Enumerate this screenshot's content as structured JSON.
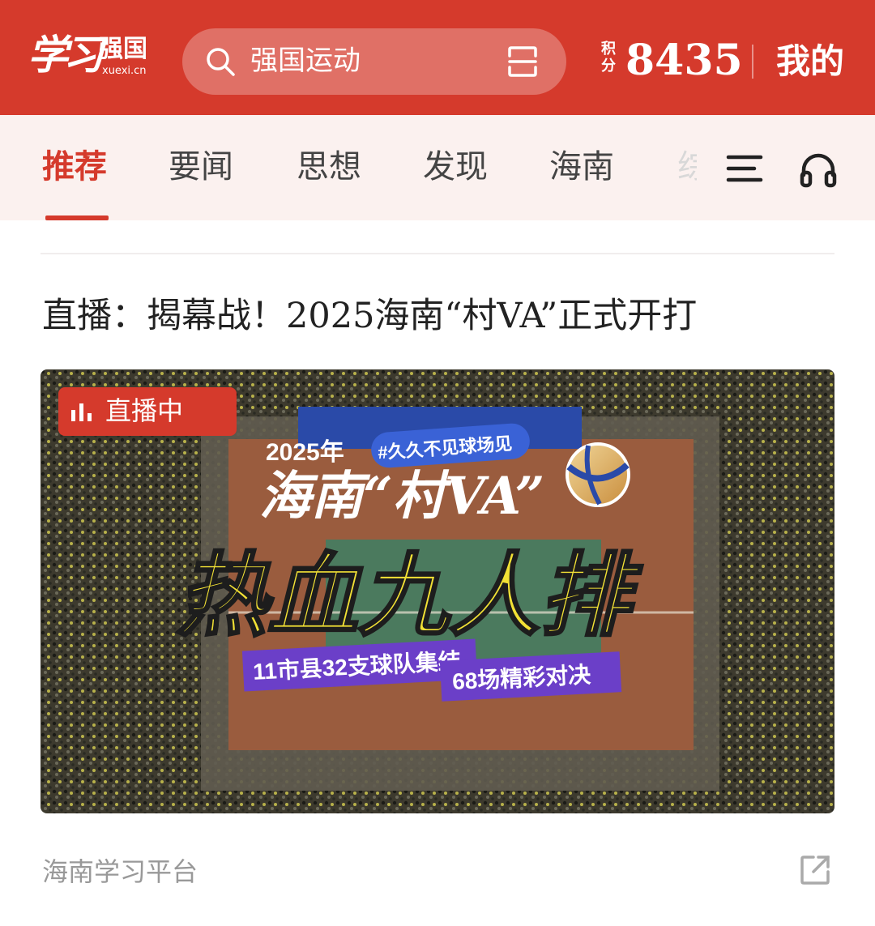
{
  "header": {
    "logo_script": "学习",
    "logo_text": "强国",
    "logo_domain": "xuexi.cn",
    "search_placeholder": "强国运动",
    "points_label": "积分",
    "points_value": "8435",
    "mine_label": "我的"
  },
  "tabs": [
    {
      "label": "推荐",
      "active": true
    },
    {
      "label": "要闻"
    },
    {
      "label": "思想"
    },
    {
      "label": "发现"
    },
    {
      "label": "海南"
    },
    {
      "label": "综"
    }
  ],
  "article": {
    "title": "直播：揭幕战！2025海南“村VA”正式开打",
    "live_badge": "直播中",
    "cover": {
      "year": "2025年",
      "hashtag": "#久久不见球场见",
      "title_line1": "海南“村VA”",
      "title_line2": "热血九人排",
      "stat1": "11市县32支球队集结",
      "stat2": "68场精彩对决"
    },
    "source": "海南学习平台"
  },
  "colors": {
    "brand": "#d53a2c",
    "tab_bg": "#fbf1ef",
    "headline_yellow": "#f2e135",
    "purple": "#6b3fc8"
  },
  "icons": [
    "search-icon",
    "scan-icon",
    "menu-icon",
    "headphones-icon",
    "live-bars-icon",
    "share-icon",
    "volleyball-icon"
  ]
}
